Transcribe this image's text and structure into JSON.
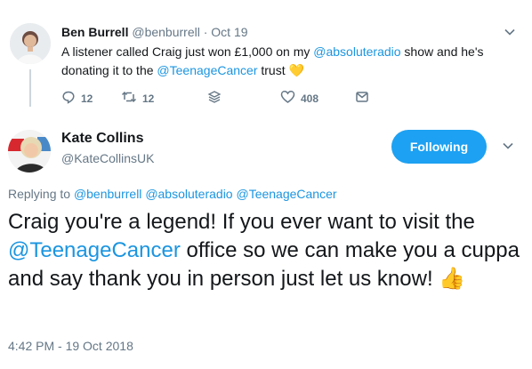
{
  "parent_tweet": {
    "author_name": "Ben Burrell",
    "author_handle": "@benburrell",
    "separator": " · ",
    "date": "Oct 19",
    "text_before": "A listener called Craig just won £1,000 on my ",
    "mention_1": "@absoluteradio",
    "text_middle": " show and he's donating it to the ",
    "mention_2": "@TeenageCancer",
    "text_after": " trust ",
    "emoji": "💛",
    "reply_count": "12",
    "retweet_count": "12",
    "like_count": "408"
  },
  "main_tweet": {
    "author_name": "Kate Collins",
    "author_handle": "@KateCollinsUK",
    "follow_label": "Following",
    "replying_prefix": "Replying to ",
    "replying_to": [
      "@benburrell",
      "@absoluteradio",
      "@TeenageCancer"
    ],
    "text_before": "Craig you're a legend! If you ever want to visit the ",
    "mention": "@TeenageCancer",
    "text_after": " office so we can make you a cuppa and say thank you in person just let us know! ",
    "emoji": "👍",
    "timestamp": "4:42 PM - 19 Oct 2018"
  },
  "icons": [
    "reply-icon",
    "retweet-icon",
    "stack-icon",
    "heart-icon",
    "message-icon",
    "chevron-down-icon"
  ],
  "colors": {
    "link": "#1b95e0",
    "button": "#1da1f2",
    "muted": "#657786",
    "text": "#14171a"
  }
}
